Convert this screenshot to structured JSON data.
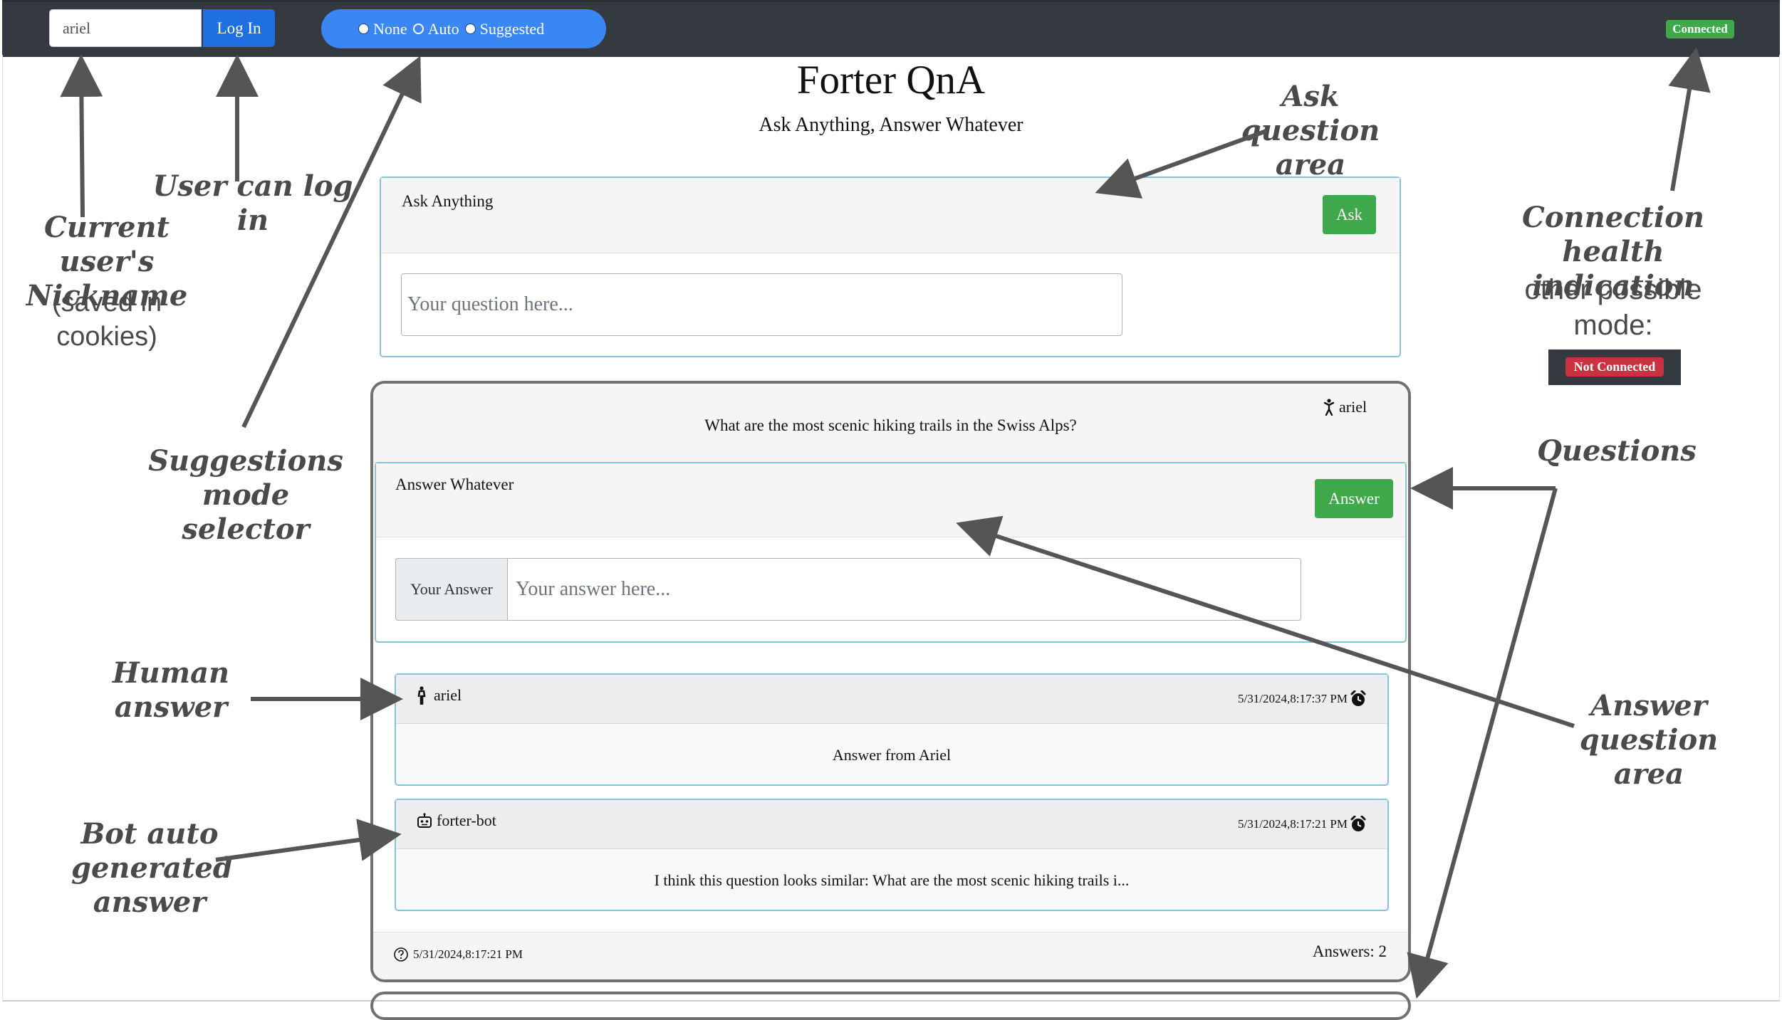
{
  "navbar": {
    "nickname_value": "ariel",
    "login_label": "Log In",
    "mode_options": [
      "None",
      "Auto",
      "Suggested"
    ],
    "mode_selected": "None",
    "status_label": "Connected",
    "status_color": "#3fa84a"
  },
  "header": {
    "title": "Forter QnA",
    "subtitle": "Ask Anything, Answer Whatever"
  },
  "ask": {
    "label": "Ask Anything",
    "button": "Ask",
    "placeholder": "Your question here..."
  },
  "question": {
    "author": "ariel",
    "text": "What are the most scenic hiking trails in the Swiss Alps?",
    "answer_label": "Answer Whatever",
    "answer_button": "Answer",
    "answer_prefix": "Your Answer",
    "answer_placeholder": "Your answer here...",
    "answers": [
      {
        "author": "ariel",
        "time": "5/31/2024,8:17:37 PM",
        "text": "Answer from Ariel",
        "icon": "person-icon"
      },
      {
        "author": "forter-bot",
        "time": "5/31/2024,8:17:21 PM",
        "text": "I think this question looks similar: What are the most scenic hiking trails i...",
        "icon": "robot-icon"
      }
    ],
    "date": "5/31/2024,8:17:21 PM",
    "answer_count": "Answers: 2"
  },
  "annotations": {
    "nickname": "Current user's Nickname",
    "nickname_note": "(saved in cookies)",
    "login": "User can log in",
    "suggestions": "Suggestions mode selector",
    "ask_area": "Ask question area",
    "connection": "Connection health indication",
    "connection_note": "other possible mode:",
    "not_connected": "Not Connected",
    "questions": "Questions",
    "human_answer": "Human answer",
    "bot_answer": "Bot auto generated answer",
    "answer_area": "Answer question area"
  },
  "colors": {
    "navbar": "#343a40",
    "primary": "#1f6fe0",
    "success": "#3fa84a",
    "danger": "#c9323f",
    "card_border": "#87c2d9"
  }
}
